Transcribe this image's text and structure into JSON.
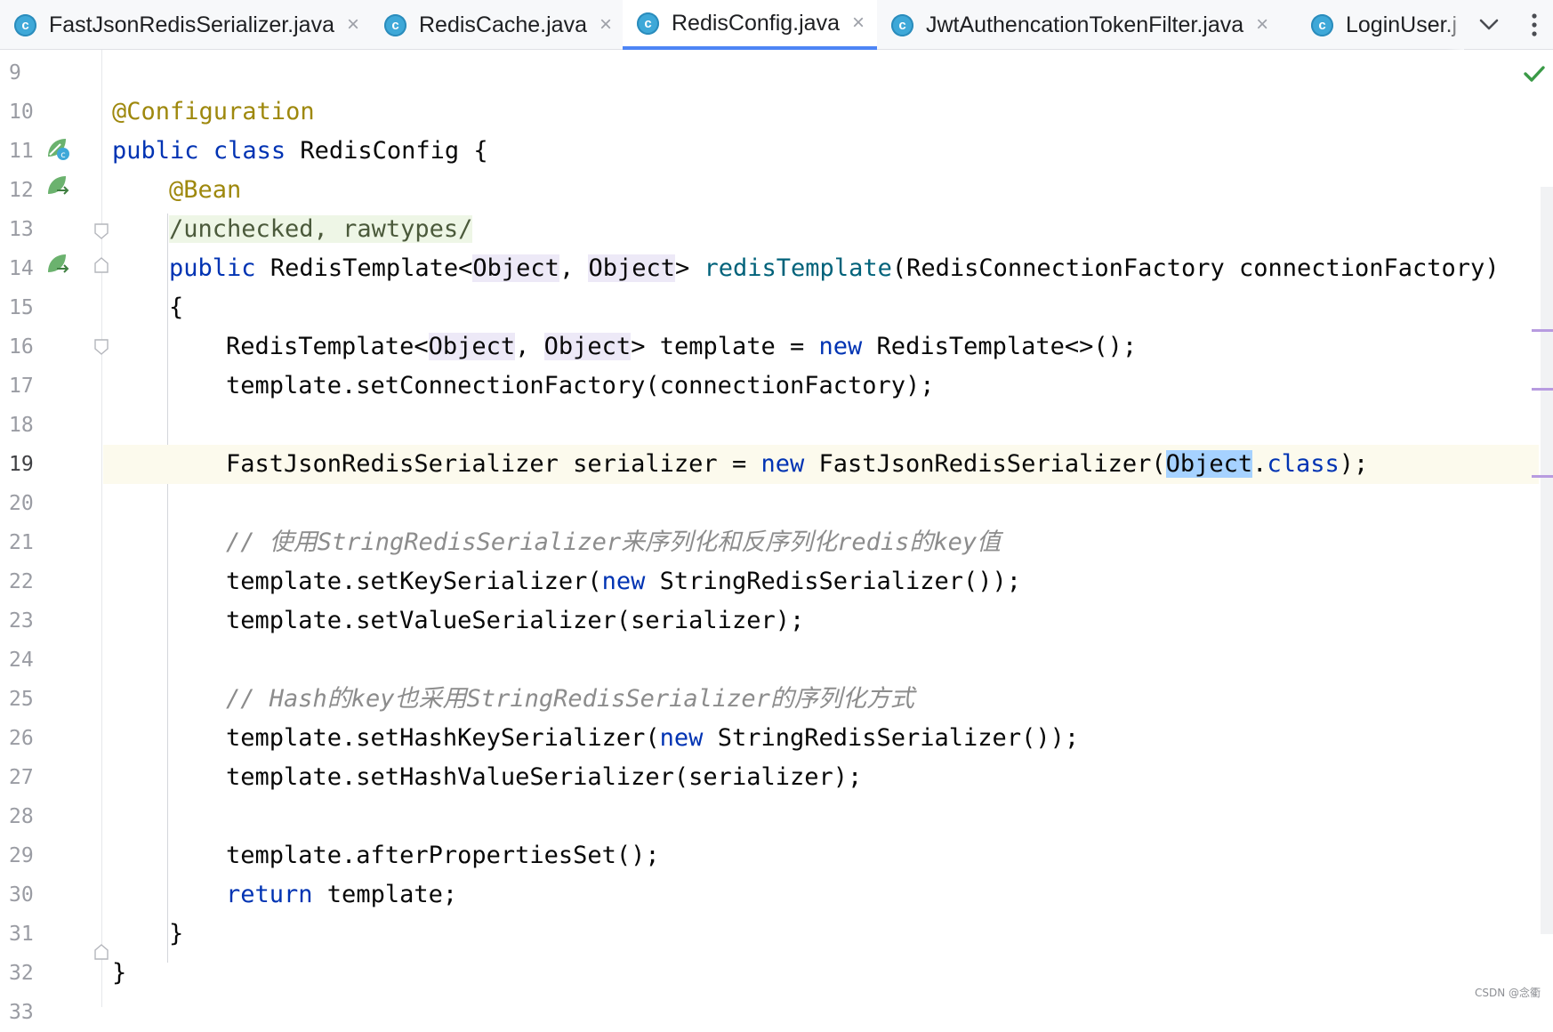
{
  "tabs": [
    {
      "label": "FastJsonRedisSerializer.java",
      "icon": "class-icon",
      "icon_letter": "c",
      "active": false,
      "closable": true
    },
    {
      "label": "RedisCache.java",
      "icon": "class-icon",
      "icon_letter": "c",
      "active": false,
      "closable": true
    },
    {
      "label": "RedisConfig.java",
      "icon": "class-icon",
      "icon_letter": "c",
      "active": true,
      "closable": true
    },
    {
      "label": "JwtAuthencationTokenFilter.java",
      "icon": "class-icon",
      "icon_letter": "c",
      "active": false,
      "closable": true
    },
    {
      "label": "LoginUser.j",
      "icon": "class-icon",
      "icon_letter": "c",
      "active": false,
      "closable": false
    }
  ],
  "tab_close_glyph": "×",
  "tab_actions": {
    "chevron_icon": "chevron-down-icon",
    "more_icon": "more-vertical-icon"
  },
  "editor": {
    "current_line": 19,
    "line_numbers": [
      "9",
      "10",
      "11",
      "12",
      "13",
      "14",
      "15",
      "16",
      "17",
      "18",
      "19",
      "20",
      "21",
      "22",
      "23",
      "24",
      "25",
      "26",
      "27",
      "28",
      "29",
      "30",
      "31",
      "32",
      "33"
    ],
    "code": {
      "l10": "@Configuration",
      "l11_a": "public",
      "l11_b": "class",
      "l11_c": "RedisConfig {",
      "l12": "@Bean",
      "l13": "/unchecked, rawtypes/",
      "l14_a": "public",
      "l14_b": "RedisTemplate<",
      "l14_c": "Object",
      "l14_d": ", ",
      "l14_e": "Object",
      "l14_f": "> ",
      "l14_g": "redisTemplate",
      "l14_h": "(RedisConnectionFactory connectionFactory)",
      "l15": "{",
      "l16_a": "RedisTemplate<",
      "l16_b": "Object",
      "l16_c": ", ",
      "l16_d": "Object",
      "l16_e": "> template = ",
      "l16_f": "new",
      "l16_g": " RedisTemplate<>();",
      "l17": "template.setConnectionFactory(connectionFactory);",
      "l19_a": "FastJsonRedisSerializer serializer = ",
      "l19_b": "new",
      "l19_c": " FastJsonRedisSerializer(",
      "l19_d": "Object",
      "l19_e": ".",
      "l19_f": "class",
      "l19_g": ");",
      "l21": "// 使用StringRedisSerializer来序列化和反序列化redis的key值",
      "l22_a": "template.setKeySerializer(",
      "l22_b": "new",
      "l22_c": " StringRedisSerializer());",
      "l23": "template.setValueSerializer(serializer);",
      "l25": "// Hash的key也采用StringRedisSerializer的序列化方式",
      "l26_a": "template.setHashKeySerializer(",
      "l26_b": "new",
      "l26_c": " StringRedisSerializer());",
      "l27": "template.setHashValueSerializer(serializer);",
      "l29": "template.afterPropertiesSet();",
      "l30_a": "return",
      "l30_b": " template;",
      "l31": "}",
      "l32": "}"
    }
  },
  "gutter_icons": {
    "l11": "spring-config-class-icon",
    "l12": "spring-bean-icon",
    "l14": "spring-bean-method-icon",
    "l19": "intention-bulb-icon"
  },
  "status": {
    "inspection_icon": "check-icon"
  },
  "colors": {
    "annotation": "#9e880d",
    "keyword": "#0033b3",
    "method": "#00627a",
    "comment": "#8c8c8c",
    "current_line_bg": "#fcfaed",
    "selection_bg": "#a6d2ff",
    "tab_underline": "#4d85f5",
    "check": "#3a9a47"
  },
  "watermark": "CSDN @念衢"
}
